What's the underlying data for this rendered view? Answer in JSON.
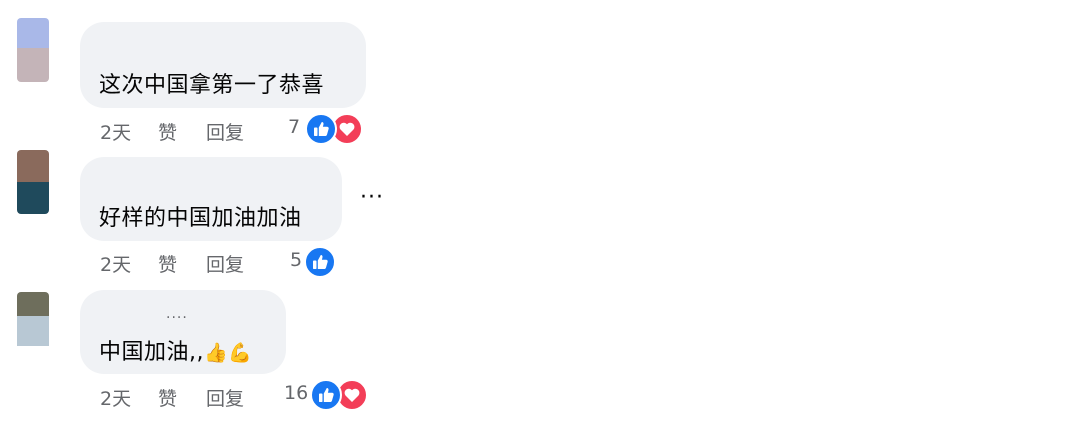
{
  "comments": [
    {
      "text": "这次中国拿第一了恭喜",
      "time": "2天",
      "like_label": "赞",
      "reply_label": "回复",
      "reaction_count": "7",
      "reactions": [
        "like-icon",
        "love-icon"
      ],
      "avatar_colors": [
        "#a9b8e8",
        "#c4b4b8"
      ]
    },
    {
      "text": "好样的中国加油加油",
      "time": "2天",
      "like_label": "赞",
      "reply_label": "回复",
      "reaction_count": "5",
      "reactions": [
        "like-icon"
      ],
      "avatar_colors": [
        "#8a6a5c",
        "#1f4a5c"
      ],
      "more_label": "···"
    },
    {
      "text": "中国加油,,",
      "emoji": [
        "👍",
        "💪"
      ],
      "dots_above": "....",
      "time": "2天",
      "like_label": "赞",
      "reply_label": "回复",
      "reaction_count": "16",
      "reactions": [
        "like-icon",
        "love-icon"
      ],
      "avatar_colors": [
        "#6e6e5c",
        "#b8c8d4"
      ]
    }
  ],
  "colors": {
    "bubble_bg": "#f0f2f5",
    "like_blue": "#1877f2",
    "love_red": "#f33e58",
    "meta_gray": "#65676b"
  }
}
